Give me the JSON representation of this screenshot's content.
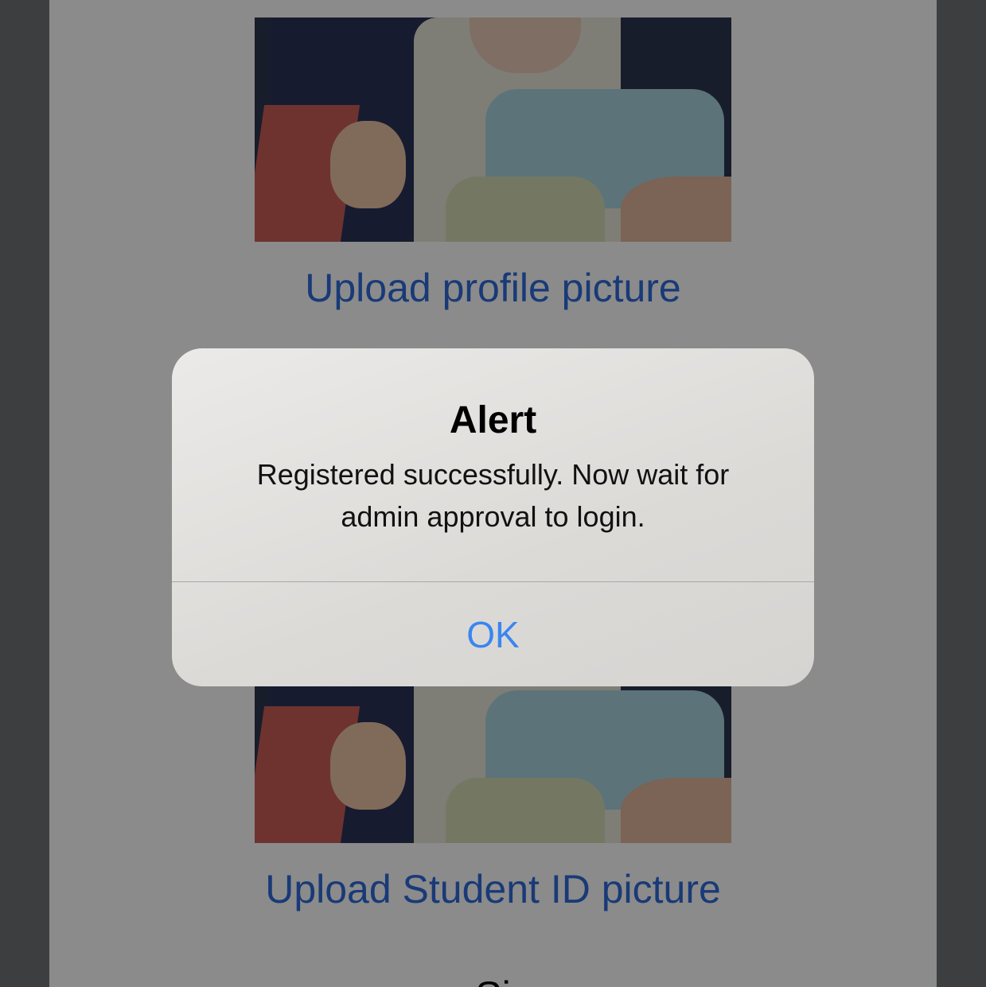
{
  "screen": {
    "upload_profile_label": "Upload profile picture",
    "upload_student_id_label": "Upload Student ID picture",
    "bottom_partial_text": "Si"
  },
  "alert": {
    "title": "Alert",
    "message_line1": "Registered successfully. Now wait for",
    "message_line2": "admin approval to login.",
    "ok_label": "OK"
  },
  "colors": {
    "link": "#2f6bd9",
    "alert_button": "#3a86f0",
    "overlay": "rgba(0,0,0,0.45)"
  }
}
